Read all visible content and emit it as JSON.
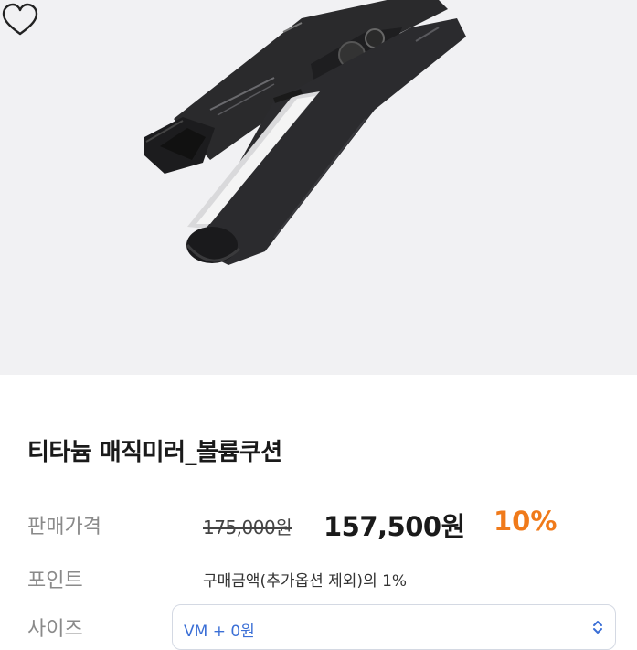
{
  "product": {
    "image_alt": "hair straightener",
    "title": "티타늄 매직미러_볼륨쿠션"
  },
  "pricing": {
    "label": "판매가격",
    "original_price": "175,000원",
    "sale_price": "157,500원",
    "discount": "10%"
  },
  "points": {
    "label": "포인트",
    "text": "구매금액(추가옵션 제외)의 1%"
  },
  "size": {
    "label": "사이즈",
    "selected": "VM  + 0원"
  },
  "colors": {
    "discount": "#f07a1a",
    "select_text": "#3b6fd6",
    "hero_bg": "#f1f1f3"
  },
  "icons": [
    "heart-icon",
    "chevron-updown-icon"
  ]
}
